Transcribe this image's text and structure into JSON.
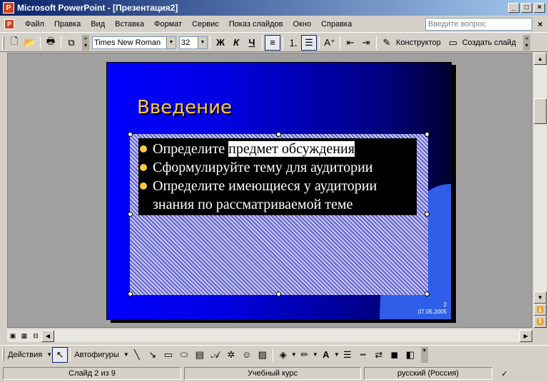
{
  "window": {
    "title": "Microsoft PowerPoint - [Презентация2]",
    "app_icon": "P"
  },
  "menu": {
    "items": [
      "Файл",
      "Правка",
      "Вид",
      "Вставка",
      "Формат",
      "Сервис",
      "Показ слайдов",
      "Окно",
      "Справка"
    ],
    "help_placeholder": "Введите вопрос"
  },
  "toolbar": {
    "font_name": "Times New Roman",
    "font_size": "32",
    "bold_label": "Ж",
    "italic_label": "К",
    "underline_label": "Ч",
    "designer_label": "Конструктор",
    "new_slide_label": "Создать слайд"
  },
  "slide": {
    "title": "Введение",
    "bullets": [
      {
        "plain": "Определите ",
        "highlight": "предмет обсуждения"
      },
      {
        "plain": "Сформулируйте тему для аудитории",
        "highlight": ""
      },
      {
        "plain": "Определите имеющиеся у аудитории знания по рассматриваемой теме",
        "highlight": ""
      }
    ],
    "number": "2",
    "date": "07.05.2005"
  },
  "drawing_toolbar": {
    "actions_label": "Действия",
    "autoshapes_label": "Автофигуры"
  },
  "status": {
    "slide_info": "Слайд 2 из 9",
    "design": "Учебный курс",
    "language": "русский (Россия)"
  },
  "colors": {
    "title_bar": "#0a246a",
    "slide_title": "#ffc840",
    "slide_bg": "#0000ff",
    "bullet": "#ffc840"
  }
}
